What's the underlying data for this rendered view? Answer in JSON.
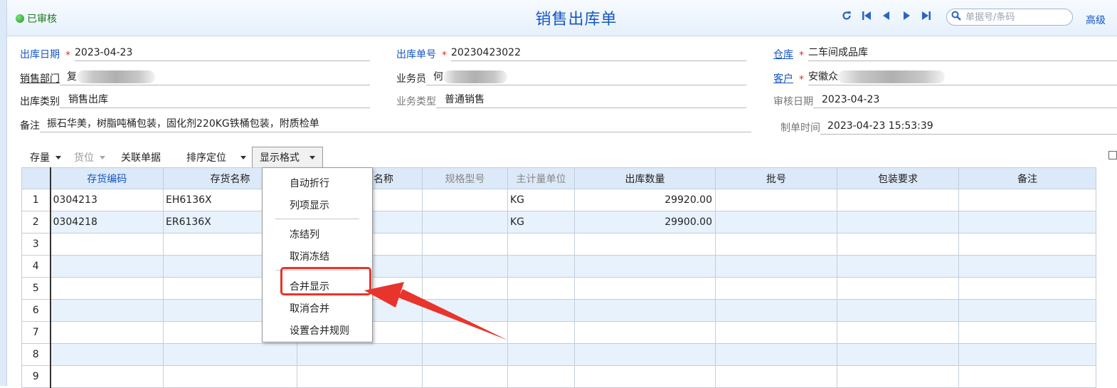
{
  "header": {
    "status": "已审核",
    "title": "销售出库单",
    "search_placeholder": "单据号/条码",
    "advanced": "高级"
  },
  "form": {
    "out_date": {
      "label": "出库日期",
      "value": "2023-04-23"
    },
    "out_no": {
      "label": "出库单号",
      "value": "20230423022"
    },
    "warehouse": {
      "label": "仓库",
      "value": "二车间成品库"
    },
    "sales_dept": {
      "label": "销售部门",
      "value": "复"
    },
    "salesman": {
      "label": "业务员",
      "value": "何"
    },
    "customer": {
      "label": "客户",
      "value": "安徽众"
    },
    "out_type": {
      "label": "出库类别",
      "value": "销售出库"
    },
    "biz_type": {
      "label": "业务类型",
      "value": "普通销售"
    },
    "audit_date": {
      "label": "审核日期",
      "value": "2023-04-23"
    },
    "remark": {
      "label": "备注",
      "value": "振石华美，树脂吨桶包装，固化剂220KG铁桶包装，附质检单"
    },
    "created_time": {
      "label": "制单时间",
      "value": "2023-04-23 15:53:39"
    }
  },
  "toolbar": {
    "stock": "存量",
    "location": "货位",
    "linked": "关联单据",
    "sort": "排序定位",
    "display_format": "显示格式"
  },
  "grid": {
    "columns": [
      "存货编码",
      "存货名称",
      "名称",
      "规格型号",
      "主计量单位",
      "出库数量",
      "批号",
      "包装要求",
      "备注"
    ],
    "rows": [
      {
        "num": "1",
        "code": "0304213",
        "name": "EH6136X",
        "unit": "KG",
        "qty": "29920.00"
      },
      {
        "num": "2",
        "code": "0304218",
        "name": "ER6136X",
        "unit": "KG",
        "qty": "29900.00"
      },
      {
        "num": "3"
      },
      {
        "num": "4"
      },
      {
        "num": "5"
      },
      {
        "num": "6"
      },
      {
        "num": "7"
      },
      {
        "num": "8"
      },
      {
        "num": "9"
      }
    ]
  },
  "menu": {
    "items": [
      "自动折行",
      "列项显示",
      "冻结列",
      "取消冻结",
      "合并显示",
      "取消合并",
      "设置合并规则"
    ]
  },
  "colors": {
    "accent": "#1455c2",
    "required": "#e23030",
    "highlight": "#e8342c",
    "header_bg": "#dce9f8"
  }
}
